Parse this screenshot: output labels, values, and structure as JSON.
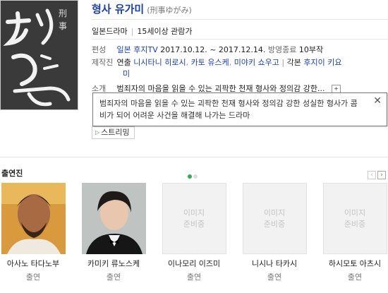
{
  "show": {
    "title": "형사 유가미",
    "original_title": "(刑事ゆがみ)",
    "genre": "일본드라마",
    "rating": "15세이상 관람가"
  },
  "info": {
    "broadcast": {
      "label": "편성",
      "channel": "일본 후지TV",
      "period": "2017.10.12. ~ 2017.12.14.",
      "status": "방영종료",
      "episodes": "10부작"
    },
    "staff": {
      "label": "제작진",
      "director_label": "연출",
      "directors": [
        "니시타니 히로시",
        "카토 유스케",
        "미야키 쇼우고"
      ],
      "writer_label": "각본",
      "writer_line1": "후지이 키요",
      "writer_line2": "미"
    },
    "intro": {
      "label": "소개",
      "short": "범죄자의 마음을 읽을 수 있는 괴팍한 천재 형사와 정의감 강한...",
      "more_icon": "plus-icon"
    }
  },
  "popup": {
    "text": "범죄자의 마음을 읽을 수 있는 괴팍한 천재 형사와 정의감 강한 성실한 형사가 콤비가 되어 어려운 사건을 해결해 나가는 드라마",
    "close_icon": "close-icon"
  },
  "streaming": {
    "label": "스트리밍",
    "icon": "play-icon"
  },
  "cast": {
    "heading": "출연진",
    "prev_icon": "chevron-left-icon",
    "next_icon": "chevron-right-icon",
    "no_image_line1": "이미지",
    "no_image_line2": "준비중",
    "members": [
      {
        "name": "아사노 타다노부",
        "role": "출연",
        "has_photo": true
      },
      {
        "name": "카미키 류노스케",
        "role": "출연",
        "has_photo": true
      },
      {
        "name": "이나모리 이즈미",
        "role": "출연",
        "has_photo": false
      },
      {
        "name": "니시나 타카시",
        "role": "출연",
        "has_photo": false
      },
      {
        "name": "하시모토 아츠시",
        "role": "출연",
        "has_photo": false
      }
    ]
  },
  "colors": {
    "title_blue": "#1a3fb3",
    "accent_green": "#2bb24c"
  }
}
